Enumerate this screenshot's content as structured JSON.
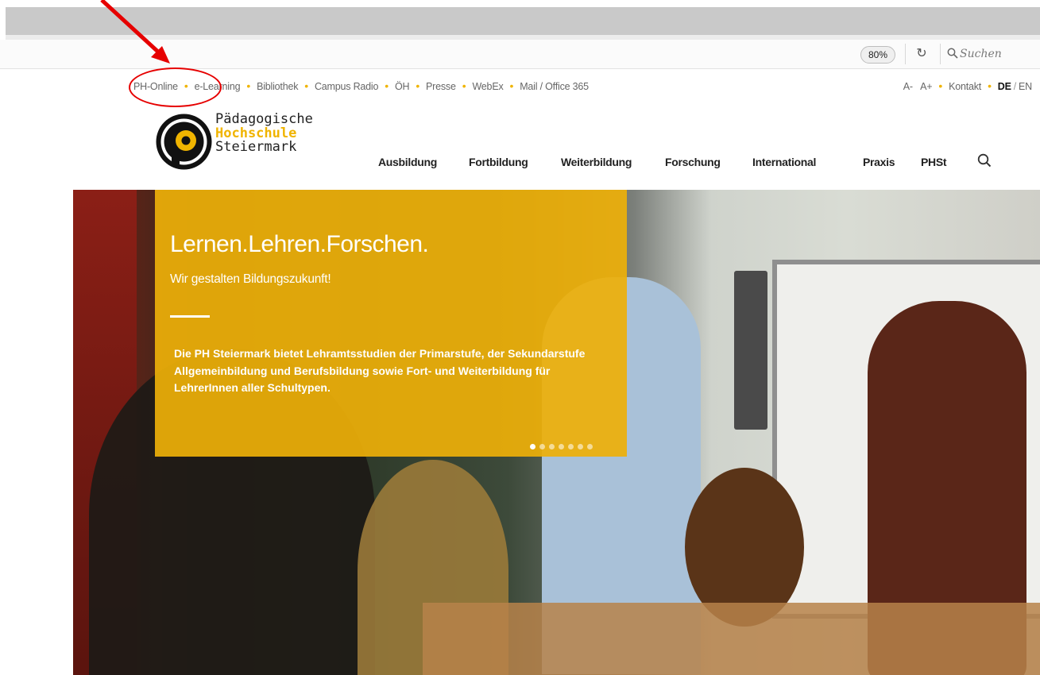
{
  "browser": {
    "zoom": "80%",
    "search_placeholder": "Suchen"
  },
  "top_links": [
    "PH-Online",
    "e-Learning",
    "Bibliothek",
    "Campus Radio",
    "ÖH",
    "Presse",
    "WebEx",
    "Mail / Office 365"
  ],
  "top_right": {
    "font_smaller": "A-",
    "font_larger": "A+",
    "contact": "Kontakt",
    "lang_de": "DE",
    "lang_sep": "/",
    "lang_en": "EN"
  },
  "logo": {
    "line1": "Pädagogische",
    "line2": "Hochschule",
    "line3": "Steiermark"
  },
  "main_nav": [
    "Ausbildung",
    "Fortbildung",
    "Weiterbildung",
    "Forschung",
    "International",
    "Praxis",
    "PHSt"
  ],
  "hero": {
    "title": "Lernen.Lehren.Forschen.",
    "subtitle": "Wir gestalten Bildungszukunft!",
    "description": "Die PH Steiermark bietet Lehramtsstudien der Primarstufe, der Sekundarstufe Allgemeinbildung und Berufsbildung sowie Fort- und Weiterbildung für LehrerInnen aller Schultypen.",
    "slide_count": 7,
    "active_slide": 1
  },
  "colors": {
    "accent": "#f0b400",
    "annotation": "#e60000"
  }
}
